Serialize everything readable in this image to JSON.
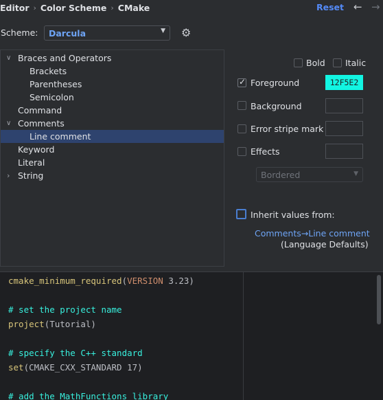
{
  "breadcrumb": [
    "Editor",
    "Color Scheme",
    "CMake"
  ],
  "header": {
    "reset_label": "Reset",
    "back_icon": "←",
    "forward_icon": "→"
  },
  "scheme": {
    "label": "Scheme:",
    "value": "Darcula"
  },
  "tree": {
    "items": [
      {
        "label": "Braces and Operators",
        "level": 0,
        "expanded": true
      },
      {
        "label": "Brackets",
        "level": 1
      },
      {
        "label": "Parentheses",
        "level": 1
      },
      {
        "label": "Semicolon",
        "level": 1
      },
      {
        "label": "Command",
        "level": 0
      },
      {
        "label": "Comments",
        "level": 0,
        "expanded": true
      },
      {
        "label": "Line comment",
        "level": 1,
        "selected": true
      },
      {
        "label": "Keyword",
        "level": 0
      },
      {
        "label": "Literal",
        "level": 0
      },
      {
        "label": "String",
        "level": 0,
        "expanded": false
      }
    ]
  },
  "attributes": {
    "bold": {
      "label": "Bold",
      "checked": false
    },
    "italic": {
      "label": "Italic",
      "checked": false
    },
    "foreground": {
      "label": "Foreground",
      "checked": true,
      "color": "12F5E2"
    },
    "background": {
      "label": "Background",
      "checked": false
    },
    "error_stripe": {
      "label": "Error stripe mark",
      "checked": false
    },
    "effects": {
      "label": "Effects",
      "checked": false,
      "style": "Bordered"
    },
    "inherit": {
      "label": "Inherit values from:",
      "checked": false,
      "link": "Comments→Line comment",
      "sub": "(Language Defaults)"
    }
  },
  "colors": {
    "accent": "#548af7",
    "selection": "#2e436e",
    "foreground_swatch": "#12f5e2",
    "comment": "#38f0de"
  },
  "preview": {
    "l1_fn": "cmake_minimum_required",
    "l1_open": "(",
    "l1_kw": "VERSION",
    "l1_rest": " 3.23)",
    "l2_cm": "# set the project name",
    "l3_fn": "project",
    "l3_rest": "(Tutorial)",
    "l4_cm": "# specify the C++ standard",
    "l5_fn": "set",
    "l5_rest": "(CMAKE_CXX_STANDARD 17)",
    "l6_cm": "# add the MathFunctions library"
  }
}
